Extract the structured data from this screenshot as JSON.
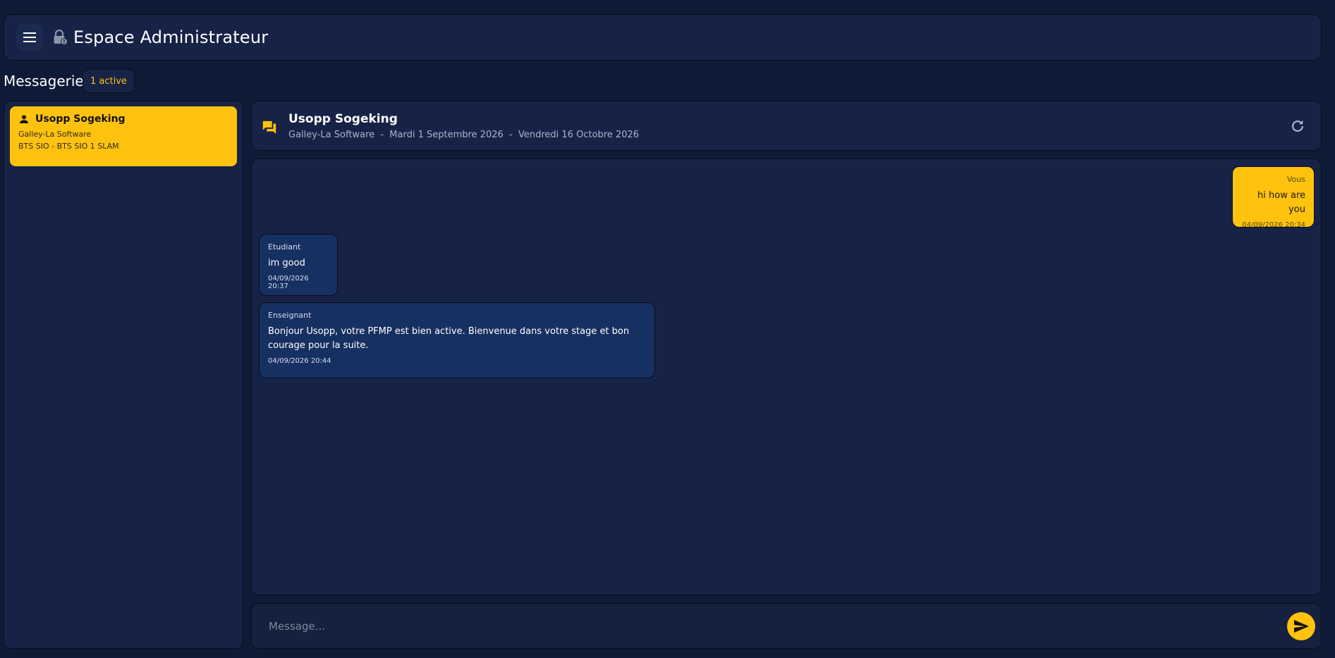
{
  "header": {
    "title": "Espace Administrateur",
    "menu_icon": "menu-icon",
    "lock_icon": "lock-icon"
  },
  "section": {
    "title": "Messagerie",
    "badge": "1 active"
  },
  "conversations": [
    {
      "name": "Usopp Sogeking",
      "company": "Galley-La Software",
      "program": "BTS SIO - BTS SIO 1 SLAM"
    }
  ],
  "chat": {
    "name": "Usopp Sogeking",
    "meta": "Galley-La Software  -  Mardi 1 Septembre 2026  -  Vendredi 16 Octobre 2026"
  },
  "messages": [
    {
      "author": "Vous",
      "text": "hi how are you",
      "time": "04/09/2026 20:34",
      "mine": true
    },
    {
      "author": "Etudiant",
      "text": "im good",
      "time": "04/09/2026 20:37",
      "mine": false
    },
    {
      "author": "Enseignant",
      "text": "Bonjour Usopp, votre PFMP est bien active. Bienvenue dans votre stage et bon courage pour la suite.",
      "time": "04/09/2026 20:44",
      "mine": false
    }
  ],
  "composer": {
    "placeholder": "Message..."
  },
  "colors": {
    "background": "#0f1b36",
    "panel": "#172346",
    "accent": "#ffc20e",
    "bubble_other": "#163061"
  }
}
